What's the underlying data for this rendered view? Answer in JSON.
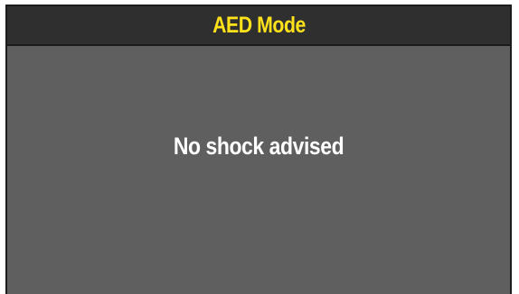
{
  "header": {
    "title": "AED Mode"
  },
  "main": {
    "message": "No shock advised"
  },
  "colors": {
    "title_text": "#ffe21a",
    "title_bar_bg": "#2f2f2f",
    "screen_bg": "#5f5f5f",
    "message_text": "#ffffff"
  }
}
